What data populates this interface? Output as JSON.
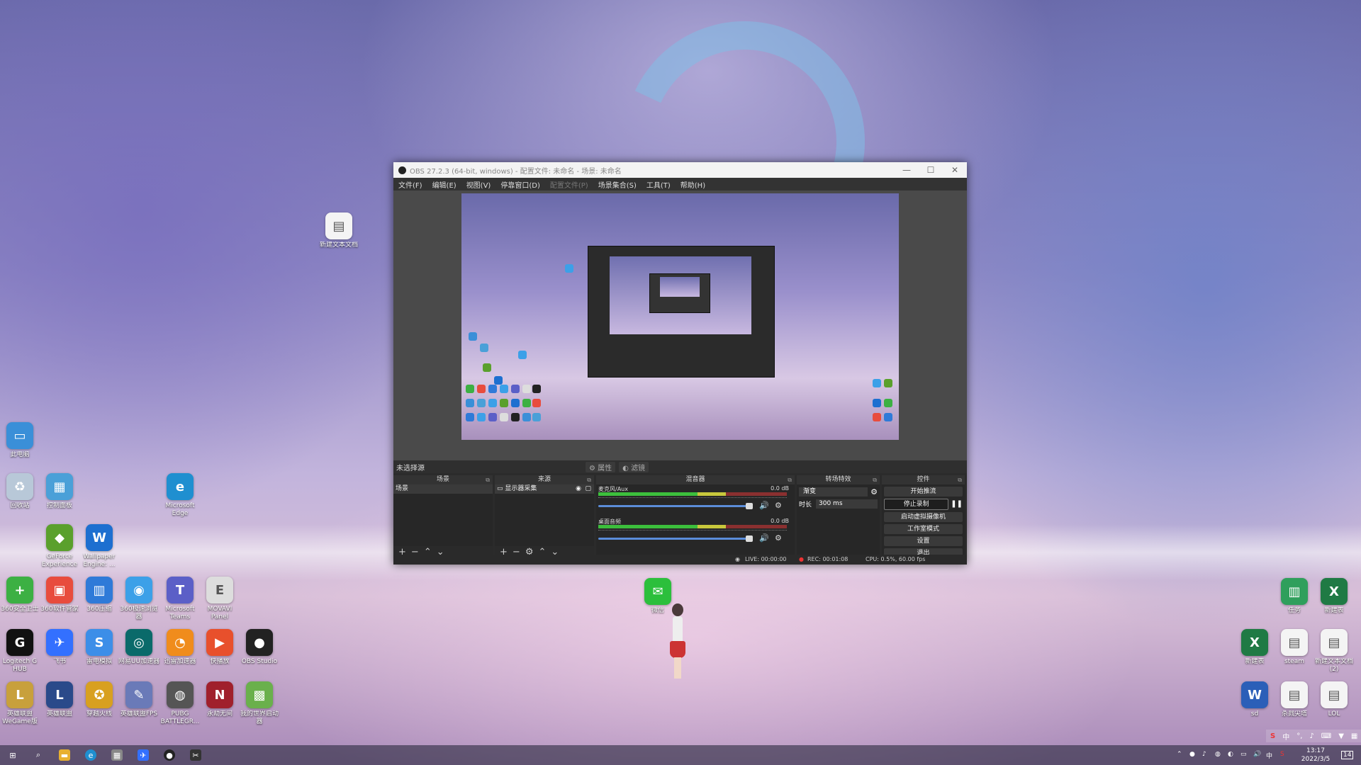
{
  "desktop": {
    "icons": [
      {
        "label": "新建文本文档",
        "color": "#f4f4f4",
        "glyph": "▤",
        "icon": "text-file-icon"
      },
      {
        "label": "此电脑",
        "color": "#3a8fd8",
        "glyph": "▭",
        "icon": "computer-icon"
      },
      {
        "label": "回收站",
        "color": "#b8c8d8",
        "glyph": "♻",
        "icon": "recycle-bin-icon"
      },
      {
        "label": "控制面板",
        "color": "#4aa0d8",
        "glyph": "▦",
        "icon": "control-panel-icon"
      },
      {
        "label": "Microsoft Edge",
        "color": "#1f8fd0",
        "glyph": "e",
        "icon": "edge-icon"
      },
      {
        "label": "GeForce Experience",
        "color": "#5aa02c",
        "glyph": "◆",
        "icon": "geforce-icon"
      },
      {
        "label": "Wallpaper Engine: ...",
        "color": "#1d6fd0",
        "glyph": "W",
        "icon": "wallpaper-engine-icon"
      },
      {
        "label": "360安全卫士",
        "color": "#3cb043",
        "glyph": "+",
        "icon": "360-safe-icon"
      },
      {
        "label": "360软件管家",
        "color": "#e84c3d",
        "glyph": "▣",
        "icon": "360-software-icon"
      },
      {
        "label": "360压缩",
        "color": "#2f7ad8",
        "glyph": "▥",
        "icon": "360-zip-icon"
      },
      {
        "label": "360极速浏览器",
        "color": "#3ca0e8",
        "glyph": "◉",
        "icon": "360-browser-icon"
      },
      {
        "label": "Microsoft Teams",
        "color": "#5b5fc7",
        "glyph": "T",
        "icon": "teams-icon"
      },
      {
        "label": "MOVAVI Panel",
        "color": "#dddddd",
        "glyph": "E",
        "icon": "movavi-icon"
      },
      {
        "label": "Logitech G HUB",
        "color": "#111111",
        "glyph": "G",
        "icon": "logitech-icon"
      },
      {
        "label": "飞书",
        "color": "#3370ff",
        "glyph": "✈",
        "icon": "feishu-icon"
      },
      {
        "label": "雷电模拟",
        "color": "#3c8ee8",
        "glyph": "S",
        "icon": "emulator-icon"
      },
      {
        "label": "网易UU加速器",
        "color": "#0a6a6a",
        "glyph": "◎",
        "icon": "uu-accelerator-icon"
      },
      {
        "label": "迅雷加速器",
        "color": "#f08c1c",
        "glyph": "◔",
        "icon": "accelerator-icon"
      },
      {
        "label": "快播放",
        "color": "#e8502c",
        "glyph": "▶",
        "icon": "player-icon"
      },
      {
        "label": "OBS Studio",
        "color": "#222222",
        "glyph": "●",
        "icon": "obs-icon"
      },
      {
        "label": "英雄联盟WeGame版",
        "color": "#c8a03c",
        "glyph": "L",
        "icon": "lol-wegame-icon"
      },
      {
        "label": "英雄联盟",
        "color": "#2a4a8a",
        "glyph": "L",
        "icon": "lol-icon"
      },
      {
        "label": "穿越火线",
        "color": "#d8a020",
        "glyph": "✪",
        "icon": "crossfire-icon"
      },
      {
        "label": "英雄联盟FPS",
        "color": "#6a7ab8",
        "glyph": "✎",
        "icon": "fps-tool-icon"
      },
      {
        "label": "PUBG BATTLEGR...",
        "color": "#555555",
        "glyph": "◍",
        "icon": "pubg-icon"
      },
      {
        "label": "永劫无间",
        "color": "#a0202c",
        "glyph": "N",
        "icon": "naraka-icon"
      },
      {
        "label": "我的世界启动器",
        "color": "#6ab04c",
        "glyph": "▩",
        "icon": "minecraft-icon"
      },
      {
        "label": "微信",
        "color": "#2cbf3c",
        "glyph": "✉",
        "icon": "wechat-icon"
      },
      {
        "label": "任务",
        "color": "#2f9f5c",
        "glyph": "▥",
        "icon": "task-icon"
      },
      {
        "label": "新建表",
        "color": "#1f7a44",
        "glyph": "X",
        "icon": "excel-icon"
      },
      {
        "label": "新建表",
        "color": "#1f7a44",
        "glyph": "X",
        "icon": "excel-icon-2"
      },
      {
        "label": "steam",
        "color": "#f4f4f4",
        "glyph": "▤",
        "icon": "steam-file-icon"
      },
      {
        "label": "新建文本文档(2)",
        "color": "#f4f4f4",
        "glyph": "▤",
        "icon": "text-file-icon-2"
      },
      {
        "label": "sd",
        "color": "#2b5fb8",
        "glyph": "W",
        "icon": "word-icon"
      },
      {
        "label": "杀戮尖塔",
        "color": "#f4f4f4",
        "glyph": "▤",
        "icon": "text-file-icon-3"
      },
      {
        "label": "LOL",
        "color": "#f4f4f4",
        "glyph": "▤",
        "icon": "text-file-icon-4"
      }
    ]
  },
  "obs": {
    "title": "OBS 27.2.3 (64-bit, windows) - 配置文件: 未命名 - 场景: 未命名",
    "menu": [
      "文件(F)",
      "编辑(E)",
      "视图(V)",
      "停靠窗口(D)",
      "配置文件(P)",
      "场景集合(S)",
      "工具(T)",
      "帮助(H)"
    ],
    "no_source": "未选择源",
    "props_btn": "属性",
    "filters_btn": "滤镜",
    "docks": {
      "scenes_title": "场景",
      "scene_item": "场景",
      "sources_title": "来源",
      "source_item": "显示器采集",
      "mixer_title": "混音器",
      "channels": [
        {
          "name": "麦克风/Aux",
          "db": "0.0 dB"
        },
        {
          "name": "桌面音频",
          "db": "0.0 dB"
        }
      ],
      "transitions_title": "转场特效",
      "transition_value": "渐变",
      "duration_label": "时长",
      "duration_value": "300 ms",
      "controls_title": "控件",
      "controls": [
        "开始推流",
        "停止录制",
        "启动虚拟摄像机",
        "工作室模式",
        "设置",
        "退出"
      ]
    },
    "status": {
      "live": "LIVE: 00:00:00",
      "rec": "REC: 00:01:08",
      "cpu": "CPU: 0.5%, 60.00 fps"
    }
  },
  "taskbar": {
    "time": "13:17",
    "date": "2022/3/5",
    "ime": "中",
    "notif_count": "14"
  }
}
